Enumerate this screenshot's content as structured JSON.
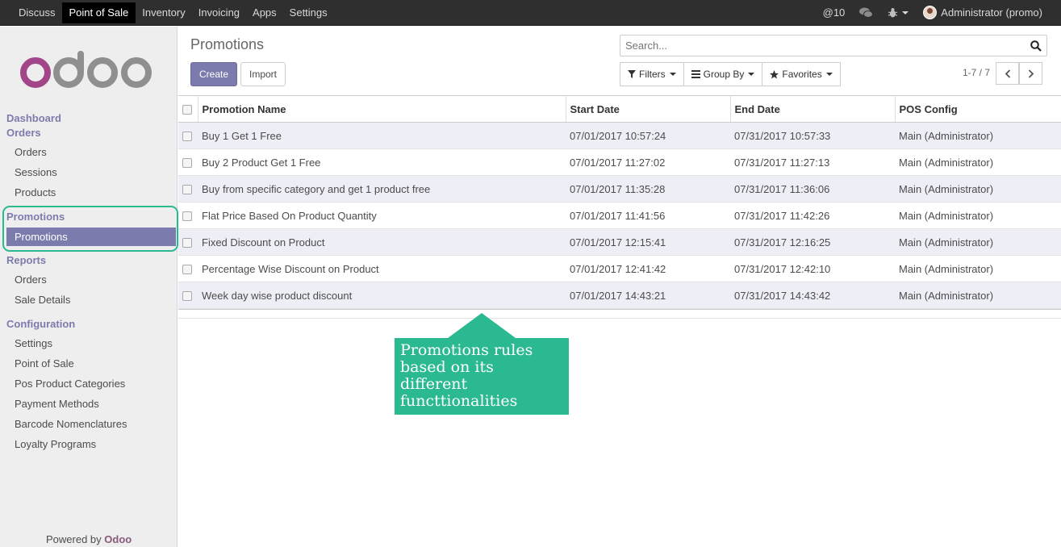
{
  "topbar": {
    "menu": [
      "Discuss",
      "Point of Sale",
      "Inventory",
      "Invoicing",
      "Apps",
      "Settings"
    ],
    "active": "Point of Sale",
    "mentions": "@10",
    "user": "Administrator (promo)"
  },
  "sidebar": {
    "sections": {
      "dashboard": "Dashboard",
      "orders": "Orders",
      "promotions": "Promotions",
      "reports": "Reports",
      "configuration": "Configuration"
    },
    "orders_items": [
      "Orders",
      "Sessions",
      "Products"
    ],
    "promotions_items": [
      "Promotions"
    ],
    "reports_items": [
      "Orders",
      "Sale Details"
    ],
    "configuration_items": [
      "Settings",
      "Point of Sale",
      "Pos Product Categories",
      "Payment Methods",
      "Barcode Nomenclatures",
      "Loyalty Programs"
    ],
    "powered_prefix": "Powered by",
    "powered_brand": "Odoo"
  },
  "main": {
    "title": "Promotions",
    "create_label": "Create",
    "import_label": "Import",
    "search_placeholder": "Search...",
    "filters_label": "Filters",
    "groupby_label": "Group By",
    "favorites_label": "Favorites",
    "pager": "1-7 / 7"
  },
  "table": {
    "columns": [
      "Promotion Name",
      "Start Date",
      "End Date",
      "POS Config"
    ],
    "rows": [
      [
        "Buy 1 Get 1 Free",
        "07/01/2017 10:57:24",
        "07/31/2017 10:57:33",
        "Main (Administrator)"
      ],
      [
        "Buy 2 Product Get 1 Free",
        "07/01/2017 11:27:02",
        "07/31/2017 11:27:13",
        "Main (Administrator)"
      ],
      [
        "Buy from specific category and get 1 product free",
        "07/01/2017 11:35:28",
        "07/31/2017 11:36:06",
        "Main (Administrator)"
      ],
      [
        "Flat Price Based On Product Quantity",
        "07/01/2017 11:41:56",
        "07/31/2017 11:42:26",
        "Main (Administrator)"
      ],
      [
        "Fixed Discount on Product",
        "07/01/2017 12:15:41",
        "07/31/2017 12:16:25",
        "Main (Administrator)"
      ],
      [
        "Percentage Wise Discount on Product",
        "07/01/2017 12:41:42",
        "07/31/2017 12:42:10",
        "Main (Administrator)"
      ],
      [
        "Week day wise product discount",
        "07/01/2017 14:43:21",
        "07/31/2017 14:43:42",
        "Main (Administrator)"
      ]
    ]
  },
  "callout": {
    "text": "Promotions rules based on its different functtionalities"
  },
  "colors": {
    "brand": "#7c7bad",
    "accent": "#2bb992",
    "topbar": "#2f2f2f"
  }
}
